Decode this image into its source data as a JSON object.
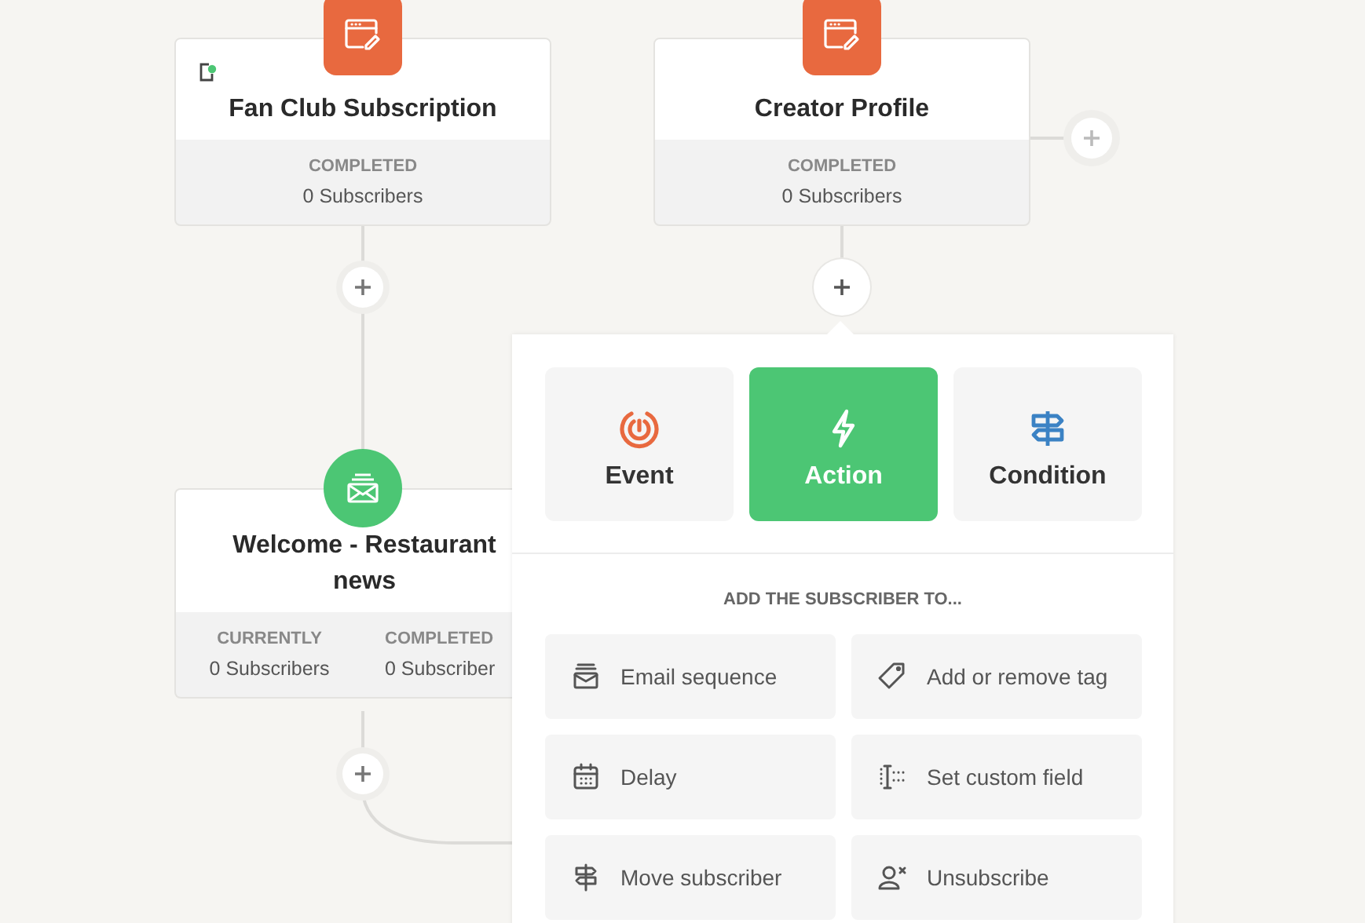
{
  "nodes": [
    {
      "kind": "form",
      "title": "Fan Club Subscription",
      "status_indicator": true,
      "stats": [
        {
          "label": "COMPLETED",
          "value": "0 Subscribers"
        }
      ]
    },
    {
      "kind": "form",
      "title": "Creator Profile",
      "status_indicator": false,
      "stats": [
        {
          "label": "COMPLETED",
          "value": "0 Subscribers"
        }
      ]
    },
    {
      "kind": "email",
      "title": "Welcome - Restaurant news",
      "status_indicator": false,
      "stats": [
        {
          "label": "CURRENTLY",
          "value": "0 Subscribers"
        },
        {
          "label": "COMPLETED",
          "value": "0 Subscriber"
        }
      ]
    }
  ],
  "step_menu": {
    "tabs": [
      {
        "kind": "event",
        "label": "Event",
        "selected": false
      },
      {
        "kind": "action",
        "label": "Action",
        "selected": true
      },
      {
        "kind": "condition",
        "label": "Condition",
        "selected": false
      }
    ],
    "heading": "ADD THE SUBSCRIBER TO...",
    "items": [
      {
        "kind": "sequence",
        "label": "Email sequence"
      },
      {
        "kind": "tag",
        "label": "Add or remove tag"
      },
      {
        "kind": "delay",
        "label": "Delay"
      },
      {
        "kind": "field",
        "label": "Set custom field"
      },
      {
        "kind": "move",
        "label": "Move subscriber"
      },
      {
        "kind": "unsubscribe",
        "label": "Unsubscribe"
      }
    ]
  }
}
